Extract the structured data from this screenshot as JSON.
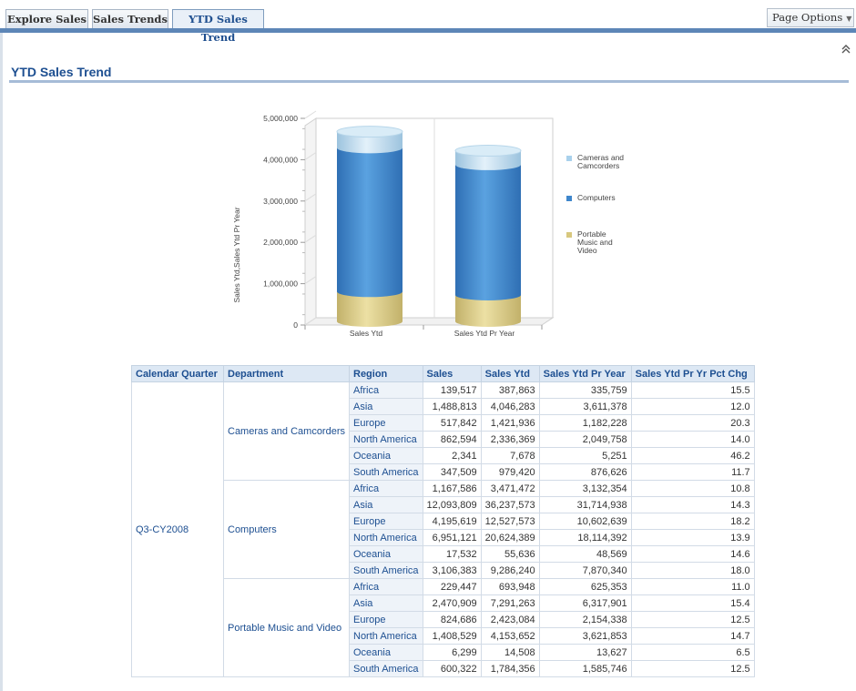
{
  "tabs": [
    {
      "label": "Explore Sales",
      "active": false
    },
    {
      "label": "Sales Trends",
      "active": false
    },
    {
      "label": "YTD Sales Trend",
      "active": true
    }
  ],
  "page_options": {
    "label": "Page Options",
    "arrow_icon": "triangle-down-icon"
  },
  "collapse_icon": "double-chevron-up-icon",
  "section": {
    "title": "YTD Sales Trend"
  },
  "chart_data": {
    "type": "bar",
    "stacked": true,
    "categories": [
      "Sales Ytd",
      "Sales Ytd Pr Year"
    ],
    "series": [
      {
        "name": "Portable Music and Video",
        "values": [
          720000,
          640000
        ],
        "color": "#d8c87e"
      },
      {
        "name": "Computers",
        "values": [
          3480000,
          3150000
        ],
        "color": "#3f86cc"
      },
      {
        "name": "Cameras and Camcorders",
        "values": [
          390000,
          340000
        ],
        "color": "#a9d1ec"
      }
    ],
    "ylabel": "Sales Ytd,Sales Ytd Pr Year",
    "xlabel": "",
    "ylim": [
      0,
      5000000
    ],
    "yticks": [
      "0",
      "1,000,000",
      "2,000,000",
      "3,000,000",
      "4,000,000",
      "5,000,000"
    ],
    "legend_position": "right",
    "grid": true
  },
  "table": {
    "headers": [
      "Calendar Quarter",
      "Department",
      "Region",
      "Sales",
      "Sales Ytd",
      "Sales Ytd Pr Year",
      "Sales Ytd Pr Yr Pct Chg"
    ],
    "quarter": "Q3-CY2008",
    "groups": [
      {
        "department": "Cameras and Camcorders",
        "rows": [
          {
            "region": "Africa",
            "sales": "139,517",
            "ytd": "387,863",
            "pr": "335,759",
            "pct": "15.5"
          },
          {
            "region": "Asia",
            "sales": "1,488,813",
            "ytd": "4,046,283",
            "pr": "3,611,378",
            "pct": "12.0"
          },
          {
            "region": "Europe",
            "sales": "517,842",
            "ytd": "1,421,936",
            "pr": "1,182,228",
            "pct": "20.3"
          },
          {
            "region": "North America",
            "sales": "862,594",
            "ytd": "2,336,369",
            "pr": "2,049,758",
            "pct": "14.0"
          },
          {
            "region": "Oceania",
            "sales": "2,341",
            "ytd": "7,678",
            "pr": "5,251",
            "pct": "46.2"
          },
          {
            "region": "South America",
            "sales": "347,509",
            "ytd": "979,420",
            "pr": "876,626",
            "pct": "11.7"
          }
        ]
      },
      {
        "department": "Computers",
        "rows": [
          {
            "region": "Africa",
            "sales": "1,167,586",
            "ytd": "3,471,472",
            "pr": "3,132,354",
            "pct": "10.8"
          },
          {
            "region": "Asia",
            "sales": "12,093,809",
            "ytd": "36,237,573",
            "pr": "31,714,938",
            "pct": "14.3"
          },
          {
            "region": "Europe",
            "sales": "4,195,619",
            "ytd": "12,527,573",
            "pr": "10,602,639",
            "pct": "18.2"
          },
          {
            "region": "North America",
            "sales": "6,951,121",
            "ytd": "20,624,389",
            "pr": "18,114,392",
            "pct": "13.9"
          },
          {
            "region": "Oceania",
            "sales": "17,532",
            "ytd": "55,636",
            "pr": "48,569",
            "pct": "14.6"
          },
          {
            "region": "South America",
            "sales": "3,106,383",
            "ytd": "9,286,240",
            "pr": "7,870,340",
            "pct": "18.0"
          }
        ]
      },
      {
        "department": "Portable Music and Video",
        "rows": [
          {
            "region": "Africa",
            "sales": "229,447",
            "ytd": "693,948",
            "pr": "625,353",
            "pct": "11.0"
          },
          {
            "region": "Asia",
            "sales": "2,470,909",
            "ytd": "7,291,263",
            "pr": "6,317,901",
            "pct": "15.4"
          },
          {
            "region": "Europe",
            "sales": "824,686",
            "ytd": "2,423,084",
            "pr": "2,154,338",
            "pct": "12.5"
          },
          {
            "region": "North America",
            "sales": "1,408,529",
            "ytd": "4,153,652",
            "pr": "3,621,853",
            "pct": "14.7"
          },
          {
            "region": "Oceania",
            "sales": "6,299",
            "ytd": "14,508",
            "pr": "13,627",
            "pct": "6.5"
          },
          {
            "region": "South America",
            "sales": "600,322",
            "ytd": "1,784,356",
            "pr": "1,585,746",
            "pct": "12.5"
          }
        ]
      }
    ]
  }
}
